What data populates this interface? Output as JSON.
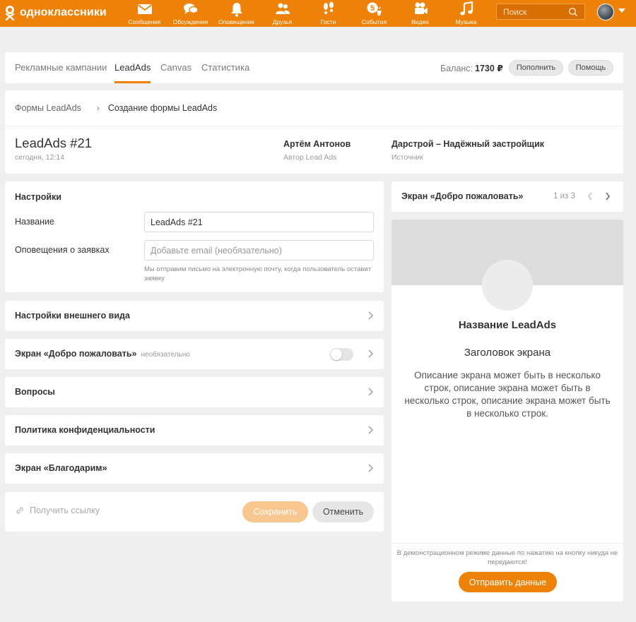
{
  "app": {
    "logo_text": "одноклассники",
    "nav": [
      {
        "label": "Сообщения",
        "icon": "envelope-icon"
      },
      {
        "label": "Обсуждения",
        "icon": "discussions-icon"
      },
      {
        "label": "Оповещение",
        "icon": "bell-icon"
      },
      {
        "label": "Друзья",
        "icon": "friends-icon"
      },
      {
        "label": "Гости",
        "icon": "footprints-icon"
      },
      {
        "label": "События",
        "icon": "events-icon"
      },
      {
        "label": "Видео",
        "icon": "video-camera-icon"
      },
      {
        "label": "Музыка",
        "icon": "music-note-icon"
      }
    ],
    "events_badge": "5",
    "search_placeholder": "Поиск"
  },
  "tabs": {
    "items": [
      "Рекламные кампании",
      "LeadAds",
      "Canvas",
      "Статистика"
    ],
    "active": "LeadAds",
    "balance_label": "Баланс:",
    "balance_value": "1730 ₽",
    "topup_label": "Пополнить",
    "help_label": "Помощь"
  },
  "breadcrumb": {
    "parent": "Формы LeadAds",
    "separator": "›",
    "current": "Создание формы LeadAds"
  },
  "form_header": {
    "title": "LeadAds #21",
    "created": "сегодня, 12:14",
    "author_name": "Артём Антонов",
    "author_label": "Автор Lead Ads",
    "source_name": "Дарстрой – Надёжный застройщик",
    "source_label": "Источник"
  },
  "settings": {
    "title": "Настройки",
    "name_label": "Название",
    "name_value": "LeadAds #21",
    "notify_label": "Оповещения о заявках",
    "notify_placeholder": "Добавьте email (необязательно)",
    "notify_hint": "Мы отправим письмо на электронную почту, когда пользователь оставит заявку"
  },
  "sections": {
    "appearance": "Настройки внешнего вида",
    "welcome": "Экран «Добро пожаловать»",
    "welcome_optional": "необязательно",
    "welcome_enabled": false,
    "questions": "Вопросы",
    "privacy": "Политика конфиденциальности",
    "thanks": "Экран «Благодарим»"
  },
  "actions": {
    "get_link": "Получить ссылку",
    "save": "Сохранить",
    "cancel": "Отменить"
  },
  "preview": {
    "screen_title": "Экран «Добро пожаловать»",
    "pager": "1 из 3",
    "form_name": "Название LeadAds",
    "screen_heading": "Заголовок экрана",
    "description": "Описание экрана может быть в несколько строк, описание экрана может быть в несколько строк, описание экрана может быть в несколько строк.",
    "demo_note": "В демонстрационном режиме данные по нажатию на кнопку никуда не передаются!",
    "submit": "Отправить данные"
  },
  "colors": {
    "brand": "#ee8208",
    "save_disabled": "#f8c790",
    "page_bg": "#efefef"
  }
}
